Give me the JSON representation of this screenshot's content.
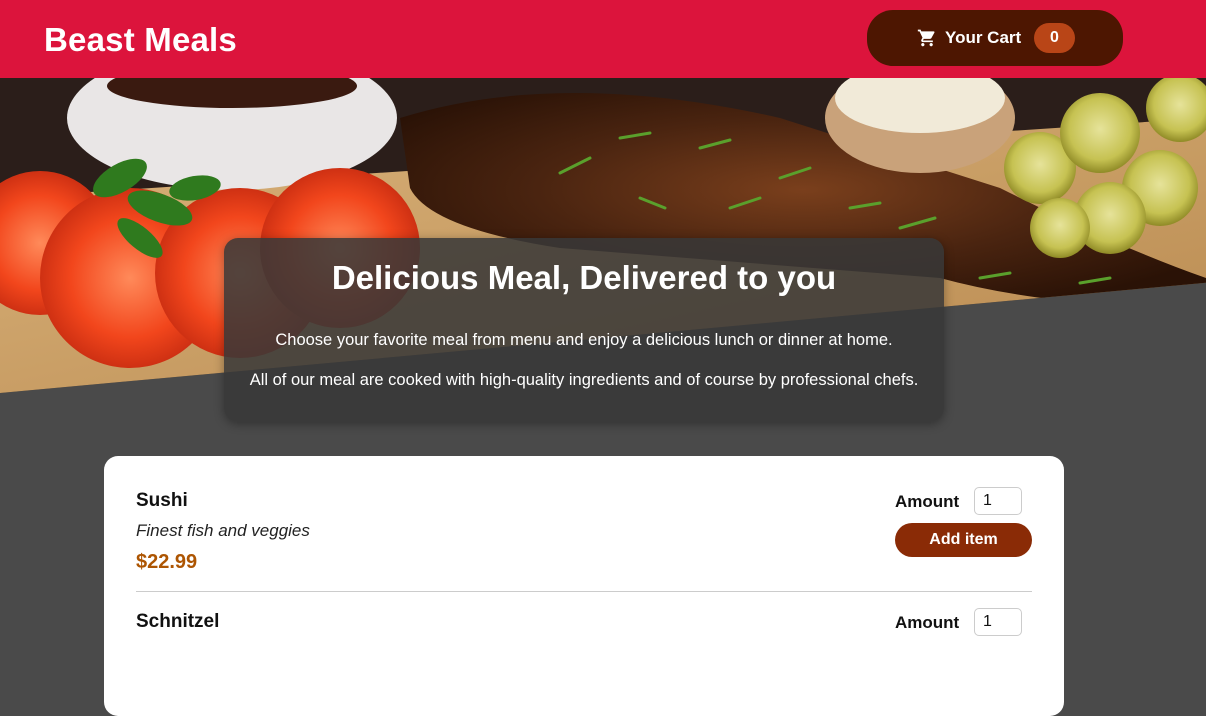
{
  "header": {
    "brand": "Beast Meals",
    "cart": {
      "icon": "shopping-cart-icon",
      "label": "Your Cart",
      "count": "0"
    }
  },
  "summary": {
    "title": "Delicious Meal, Delivered to you",
    "paragraph1": "Choose your favorite meal from menu and enjoy a delicious lunch or dinner at home.",
    "paragraph2": "All of our meal are cooked with high-quality ingredients and of course by professional chefs."
  },
  "meals": [
    {
      "name": "Sushi",
      "description": "Finest fish and veggies",
      "price": "$22.99",
      "amount_label": "Amount",
      "amount_value": "1",
      "button_label": "Add item"
    },
    {
      "name": "Schnitzel",
      "amount_label": "Amount",
      "amount_value": "1"
    }
  ],
  "colors": {
    "header_bg": "#dc143c",
    "cart_bg": "#4d1601",
    "badge_bg": "#b94517",
    "price": "#ad5502",
    "button_bg": "#8a2b06",
    "page_bg": "#4a4a4a"
  }
}
